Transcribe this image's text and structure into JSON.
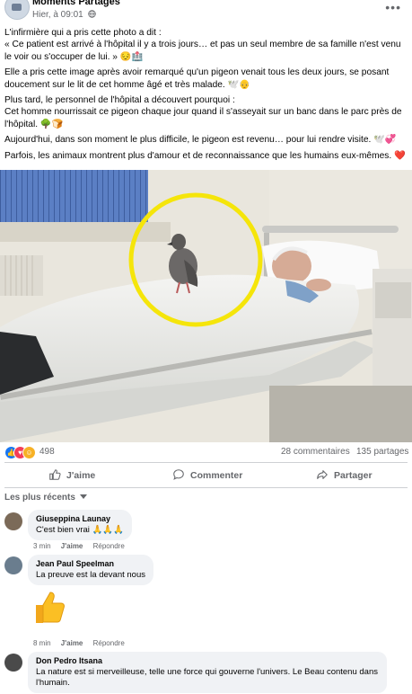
{
  "post": {
    "page_name": "Moments Partagés",
    "timestamp": "Hier, à 09:01",
    "privacy_icon": "globe-icon",
    "more_label": "•••",
    "paragraphs": [
      "L'infirmière qui a pris cette photo a dit :",
      "« Ce patient est arrivé à l'hôpital il y a trois jours… et pas un seul membre de sa famille n'est venu le voir ou s'occuper de lui. » 😔🏥",
      "Elle a pris cette image après avoir remarqué qu'un pigeon venait tous les deux jours, se posant doucement sur le lit de cet homme âgé et très malade. 🕊️👴",
      "Plus tard, le personnel de l'hôpital a découvert pourquoi :",
      "Cet homme nourrissait ce pigeon chaque jour quand il s'asseyait sur un banc dans le parc près de l'hôpital. 🌳🍞",
      "Aujourd'hui, dans son moment le plus difficile, le pigeon est revenu… pour lui rendre visite. 🕊️💞",
      "Parfois, les animaux montrent plus d'amour et de reconnaissance que les humains eux-mêmes. ❤️"
    ]
  },
  "stats": {
    "reaction_count": "498",
    "comments_count": "28 commentaires",
    "shares_count": "135 partages"
  },
  "actions": {
    "like": "J'aime",
    "comment": "Commenter",
    "share": "Partager"
  },
  "comments_section": {
    "sort_label": "Les plus récents",
    "like_label": "J'aime",
    "reply_label": "Répondre",
    "items": [
      {
        "name": "Giuseppina Launay",
        "text": "C'est bien vrai 🙏🙏🙏",
        "time": "3 min"
      },
      {
        "name": "Jean Paul Speelman",
        "text": "La preuve est la devant nous",
        "time": "8 min"
      },
      {
        "name": "Don Pedro Itsana",
        "text": "La nature est si merveilleuse, telle une force qui gouverne l'univers. Le Beau contenu dans l'humain.",
        "time": ""
      }
    ]
  },
  "colors": {
    "like_blue": "#1877f2",
    "love_red": "#f33e58",
    "highlight_circle": "#f5e50a"
  }
}
